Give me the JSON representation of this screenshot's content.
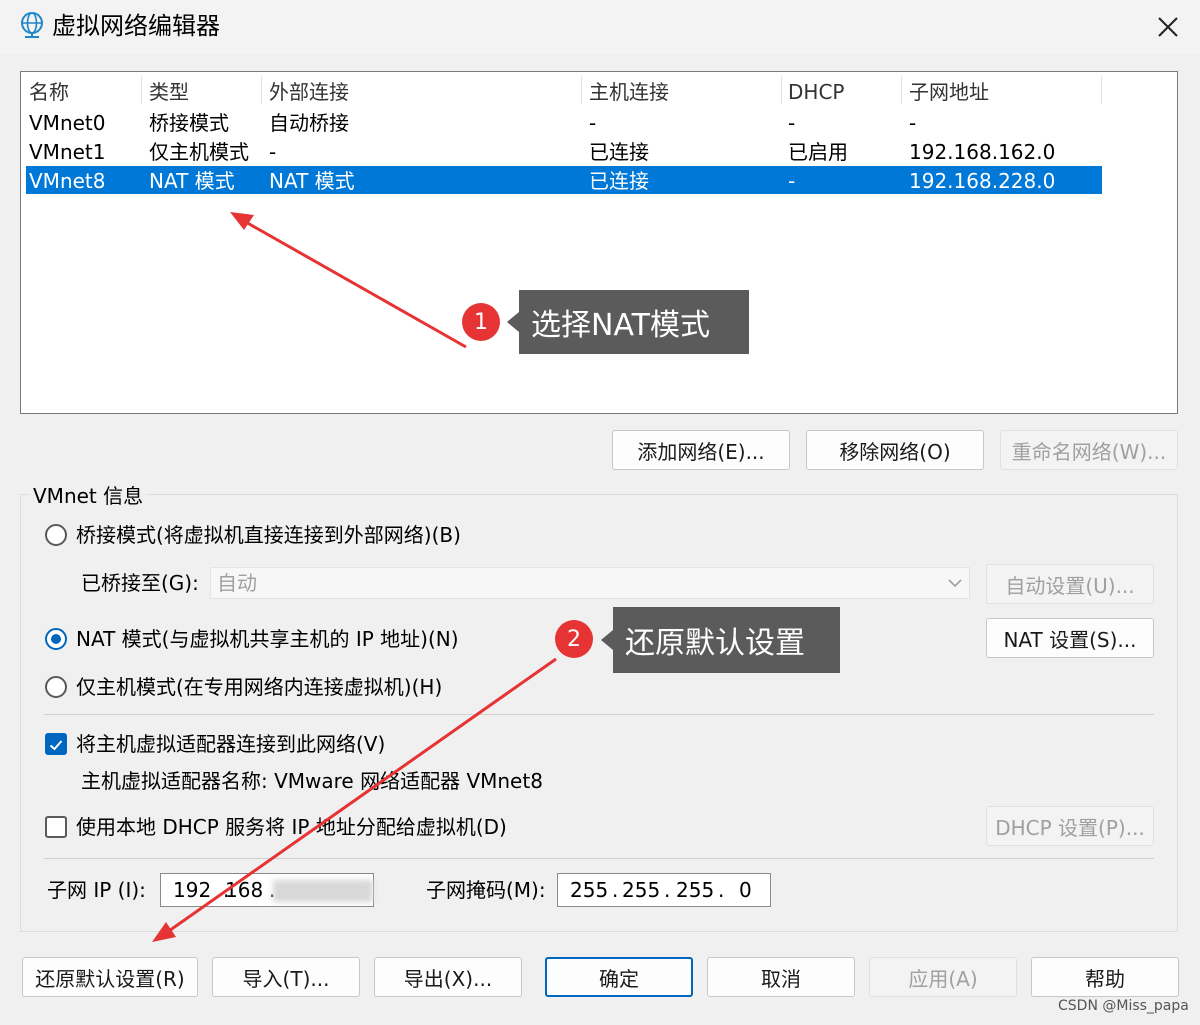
{
  "window": {
    "title": "虚拟网络编辑器",
    "close_glyph": "✕"
  },
  "network_table": {
    "columns": [
      "名称",
      "类型",
      "外部连接",
      "主机连接",
      "DHCP",
      "子网地址"
    ],
    "rows": [
      [
        "VMnet0",
        "桥接模式",
        "自动桥接",
        "-",
        "-",
        "-"
      ],
      [
        "VMnet1",
        "仅主机模式",
        "-",
        "已连接",
        "已启用",
        "192.168.162.0"
      ],
      [
        "VMnet8",
        "NAT 模式",
        "NAT 模式",
        "已连接",
        "-",
        "192.168.228.0"
      ]
    ],
    "selected_row": 2
  },
  "table_buttons": {
    "add": "添加网络(E)...",
    "remove": "移除网络(O)",
    "rename": "重命名网络(W)..."
  },
  "vmnet_info": {
    "group_label": "VMnet 信息",
    "bridged_label": "桥接模式(将虚拟机直接连接到外部网络)(B)",
    "bridged_to_label": "已桥接至(G):",
    "bridged_to_value": "自动",
    "auto_settings": "自动设置(U)...",
    "nat_label": "NAT 模式(与虚拟机共享主机的 IP 地址)(N)",
    "nat_settings": "NAT 设置(S)...",
    "hostonly_label": "仅主机模式(在专用网络内连接虚拟机)(H)",
    "connect_adapter_label": "将主机虚拟适配器连接到此网络(V)",
    "adapter_name_label": "主机虚拟适配器名称: VMware 网络适配器 VMnet8",
    "dhcp_label": "使用本地 DHCP 服务将 IP 地址分配给虚拟机(D)",
    "dhcp_settings": "DHCP 设置(P)...",
    "subnet_ip_label": "子网 IP (I):",
    "subnet_ip": [
      "192",
      "168"
    ],
    "subnet_mask_label": "子网掩码(M):",
    "subnet_mask": [
      "255",
      "255",
      "255",
      "0"
    ],
    "selected_mode": "nat",
    "connect_adapter_checked": true,
    "dhcp_checked": false
  },
  "footer_buttons": {
    "restore": "还原默认设置(R)",
    "import": "导入(T)...",
    "export": "导出(X)...",
    "ok": "确定",
    "cancel": "取消",
    "apply": "应用(A)",
    "help": "帮助"
  },
  "annotations": {
    "step1_number": "1",
    "step1_text": "选择NAT模式",
    "step2_number": "2",
    "step2_text": "还原默认设置"
  },
  "watermark": "CSDN @Miss_papa",
  "colors": {
    "selection": "#0078d7",
    "accent": "#0067c0",
    "annotation_red": "#e63333",
    "callout_bg": "#5b5b5b"
  }
}
